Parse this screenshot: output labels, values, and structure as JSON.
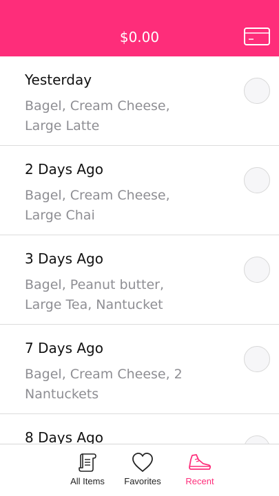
{
  "header": {
    "title": "$0.00",
    "card_icon": "credit-card-icon"
  },
  "orders": [
    {
      "title": "Yesterday",
      "items": "Bagel, Cream Cheese, Large Latte"
    },
    {
      "title": "2 Days Ago",
      "items": "Bagel, Cream Cheese, Large Chai"
    },
    {
      "title": "3 Days Ago",
      "items": "Bagel, Peanut butter, Large Tea, Nantucket"
    },
    {
      "title": "7 Days Ago",
      "items": "Bagel, Cream Cheese, 2 Nantuckets"
    },
    {
      "title": "8 Days Ago",
      "items": ""
    }
  ],
  "tabbar": {
    "tabs": [
      {
        "label": "All Items",
        "icon": "scroll-icon",
        "active": false
      },
      {
        "label": "Favorites",
        "icon": "heart-icon",
        "active": false
      },
      {
        "label": "Recent",
        "icon": "sneaker-icon",
        "active": true
      }
    ]
  },
  "colors": {
    "accent": "#fe2d7a",
    "secondary_text": "#8e8e93"
  }
}
